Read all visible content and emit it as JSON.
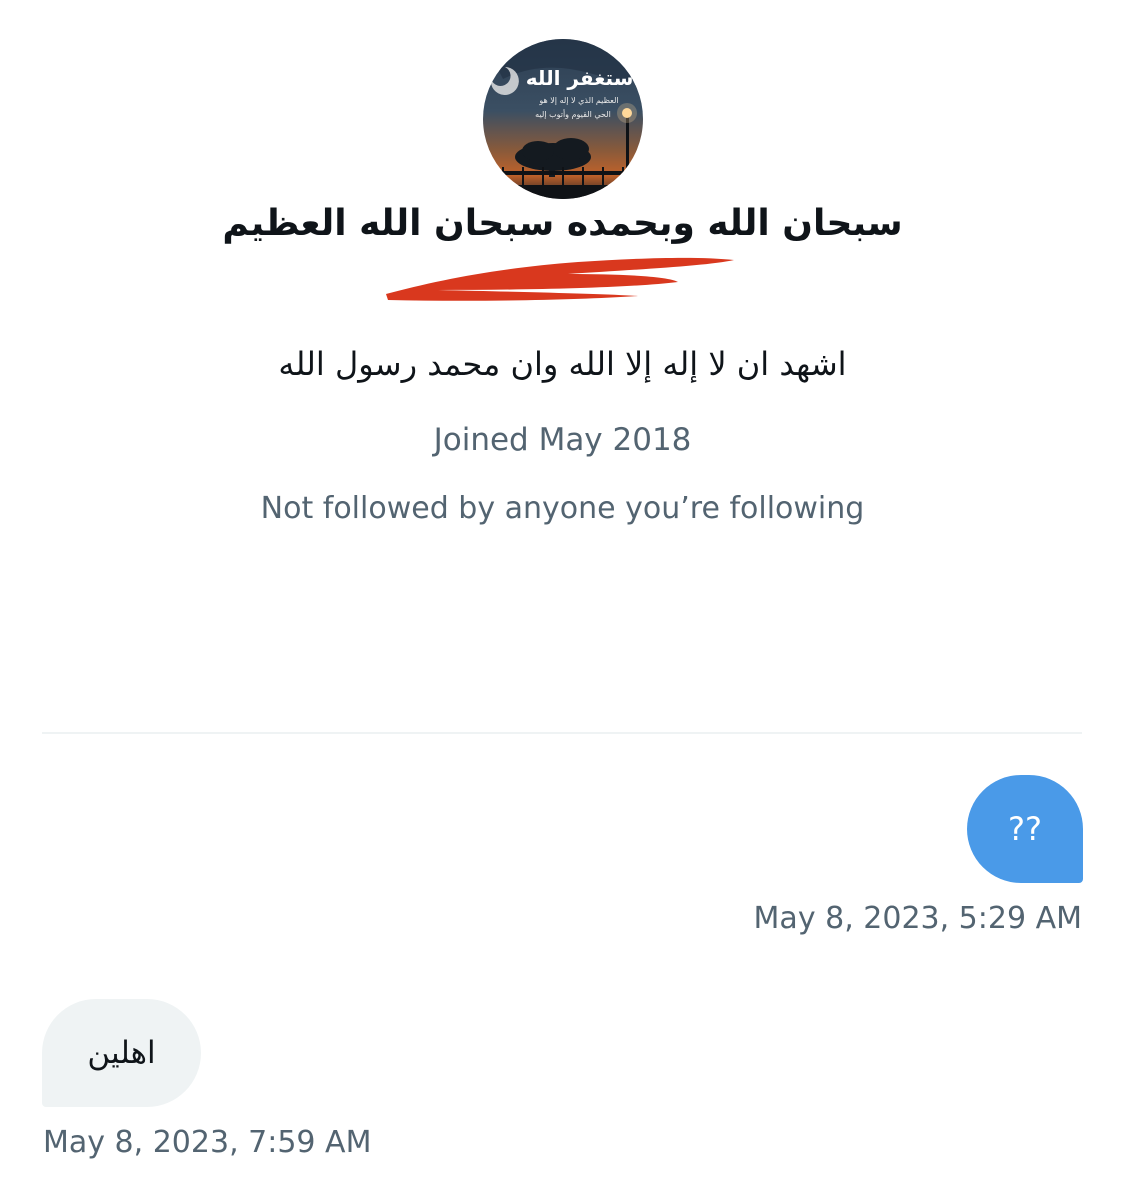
{
  "profile": {
    "avatar": {
      "icon": "profile-avatar-image",
      "title_text": "أستغفر الله",
      "subtitle_line1": "العظيم الذي لا إله إلا هو",
      "subtitle_line2": "الحي القيوم وأتوب إليه"
    },
    "display_name": "سبحان الله وبحمده سبحان الله العظيم",
    "handle_redaction_color": "#d9381e",
    "bio": "اشهد ان لا إله إلا الله وان محمد رسول الله",
    "joined": "Joined May 2018",
    "followers_note": "Not followed by anyone you’re following"
  },
  "messages": [
    {
      "direction": "sent",
      "text": "??",
      "timestamp": "May 8, 2023, 5:29 AM",
      "bubble_color": "#4a9ae8"
    },
    {
      "direction": "received",
      "text": "اهلين",
      "timestamp": "May 8, 2023, 7:59 AM",
      "bubble_color": "#eff3f4"
    }
  ],
  "colors": {
    "primary_text": "#0f1419",
    "secondary_text": "#536471",
    "divider": "#eff3f4"
  }
}
